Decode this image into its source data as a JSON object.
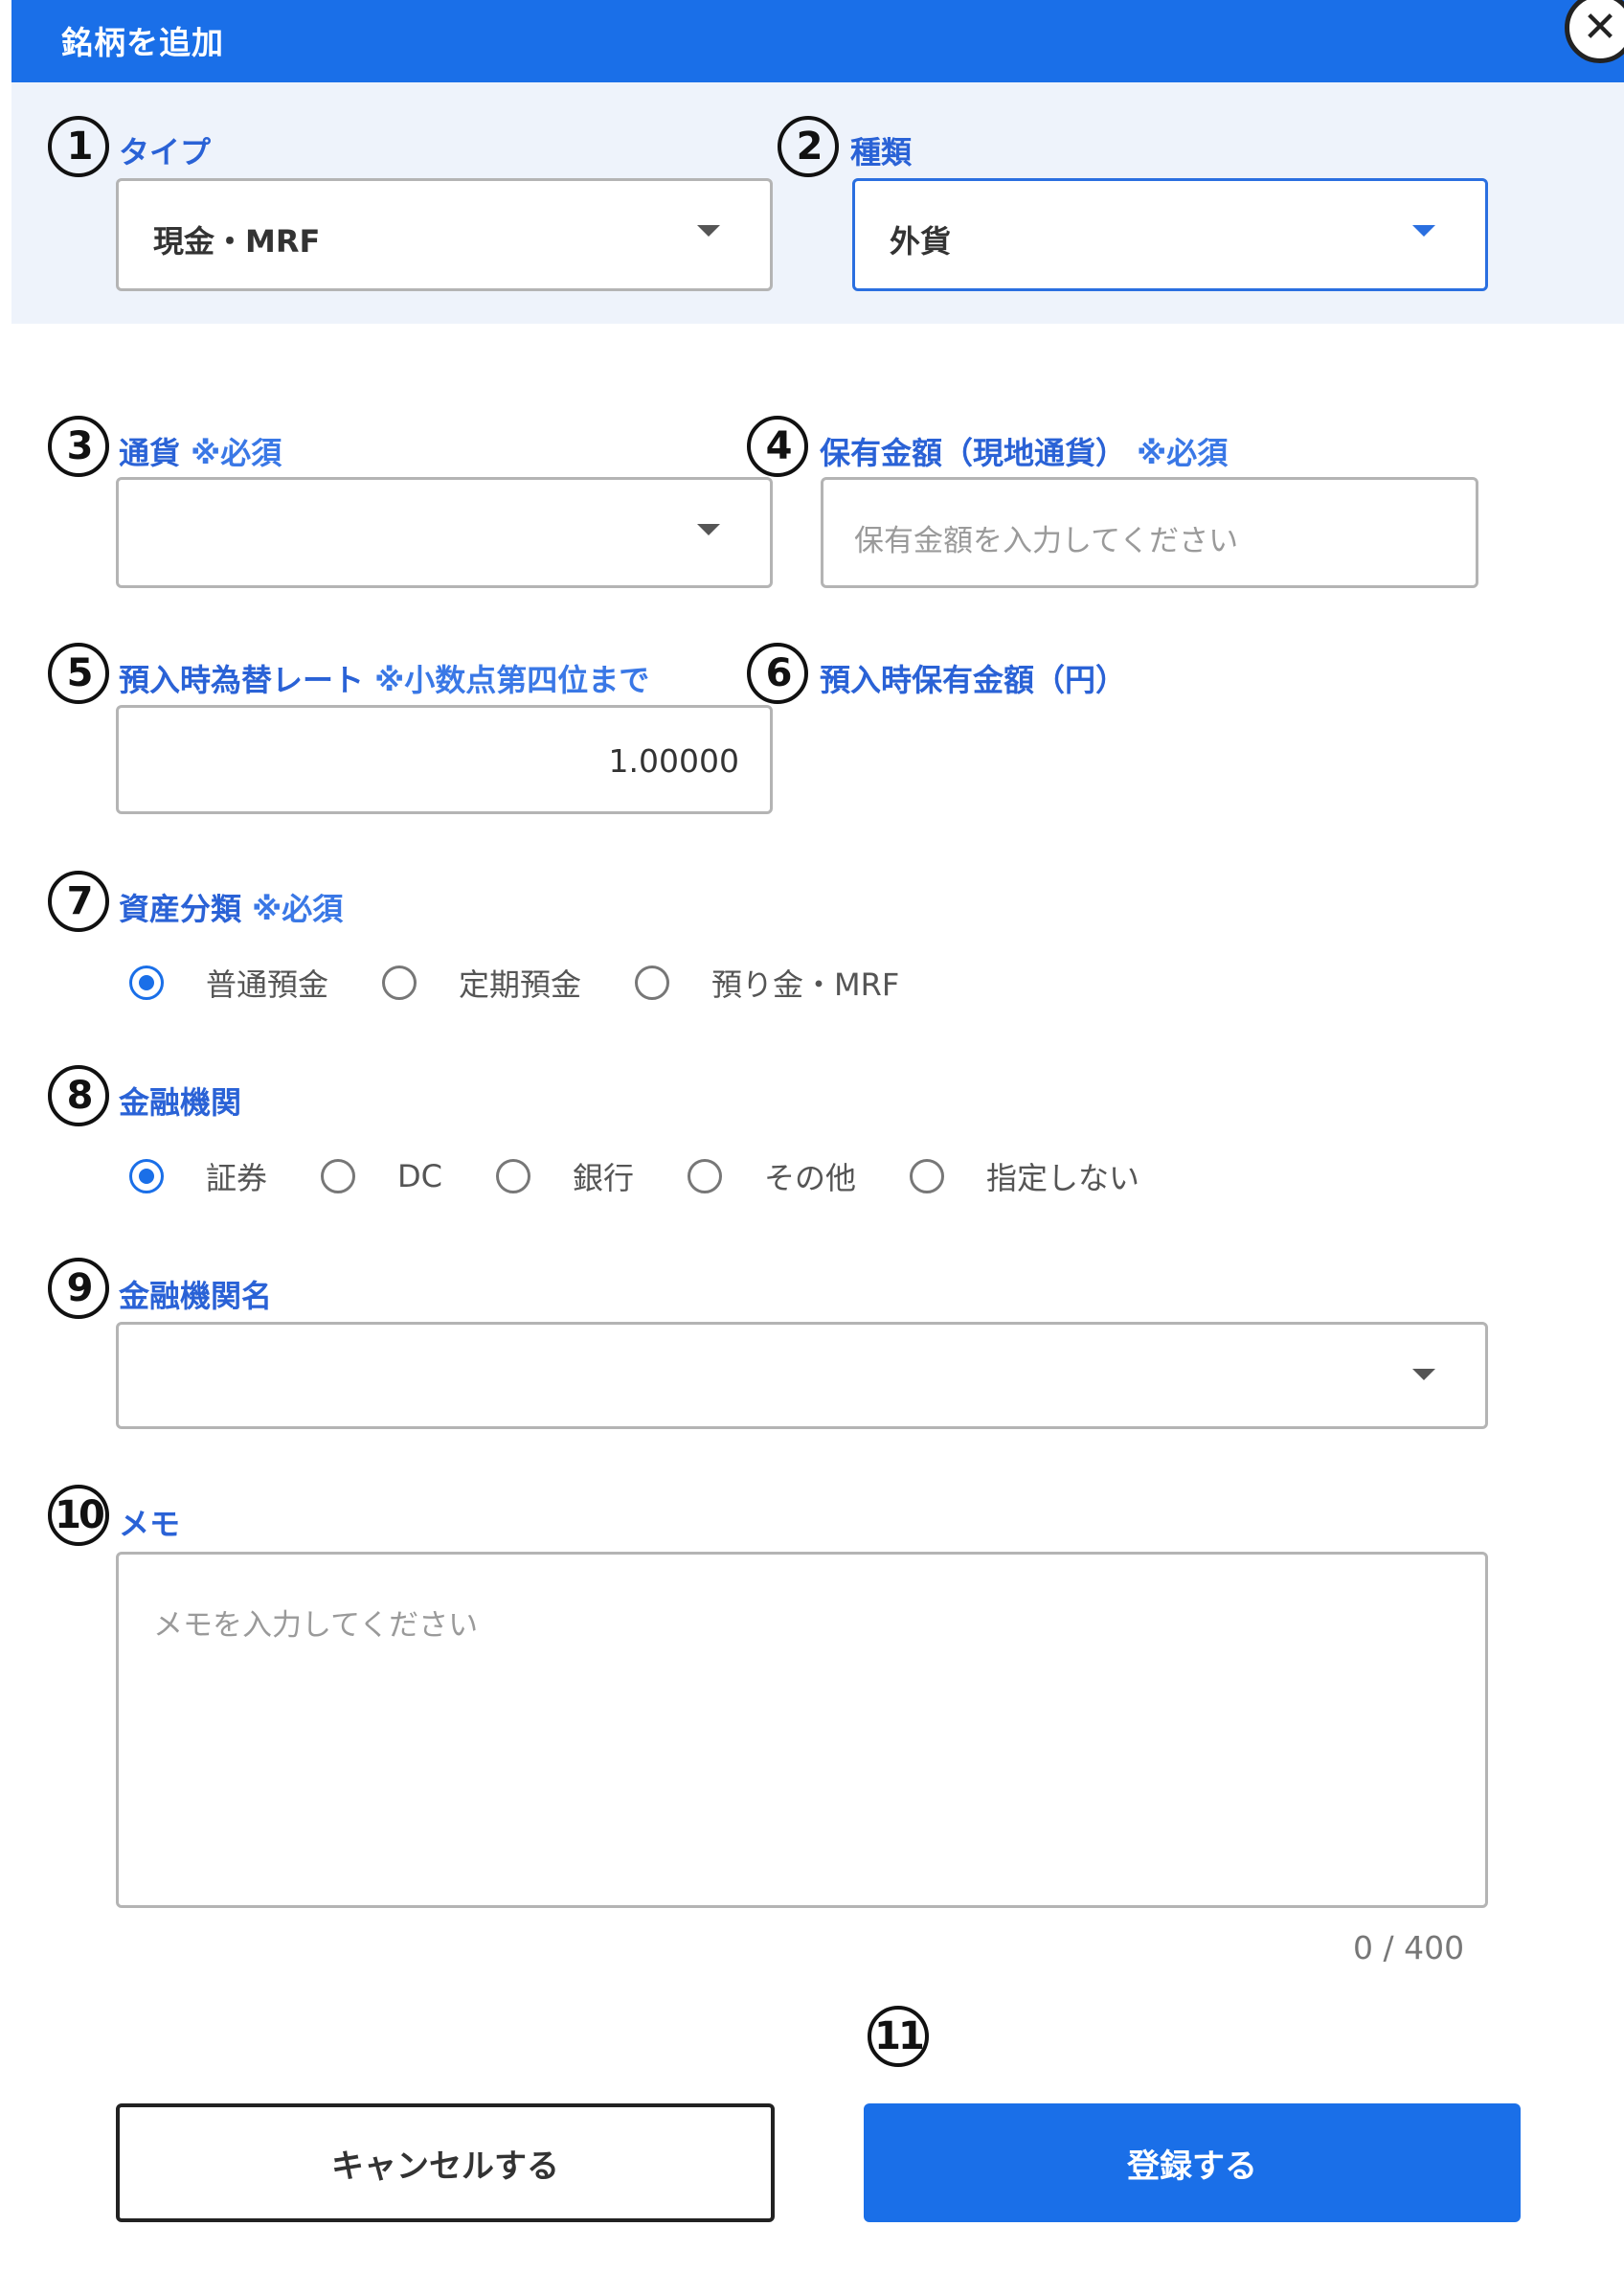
{
  "dialog": {
    "title": "銘柄を追加",
    "close_glyph": "✕"
  },
  "markers": [
    "1",
    "2",
    "3",
    "4",
    "5",
    "6",
    "7",
    "8",
    "9",
    "10",
    "11"
  ],
  "fields": {
    "type": {
      "label": "タイプ",
      "value": "現金・MRF"
    },
    "kind": {
      "label": "種類",
      "value": "外貨"
    },
    "currency": {
      "label": "通貨",
      "required": "※必須",
      "value": ""
    },
    "holding_local": {
      "label": "保有金額（現地通貨）",
      "required": "※必須",
      "placeholder": "保有金額を入力してください"
    },
    "fx_rate": {
      "label": "預入時為替レート",
      "note": "※小数点第四位まで",
      "value": "1.00000"
    },
    "holding_yen": {
      "label": "預入時保有金額（円）"
    },
    "asset_class": {
      "label": "資産分類",
      "required": "※必須",
      "options": [
        "普通預金",
        "定期預金",
        "預り金・MRF"
      ],
      "selected": "普通預金"
    },
    "institution": {
      "label": "金融機関",
      "options": [
        "証券",
        "DC",
        "銀行",
        "その他",
        "指定しない"
      ],
      "selected": "証券"
    },
    "institution_name": {
      "label": "金融機関名",
      "value": ""
    },
    "memo": {
      "label": "メモ",
      "placeholder": "メモを入力してください",
      "counter": "0 / 400"
    }
  },
  "buttons": {
    "cancel": "キャンセルする",
    "submit": "登録する"
  },
  "colors": {
    "primary": "#1a6fe8",
    "label": "#2a62d6",
    "panel_bg": "#eef3fb"
  }
}
